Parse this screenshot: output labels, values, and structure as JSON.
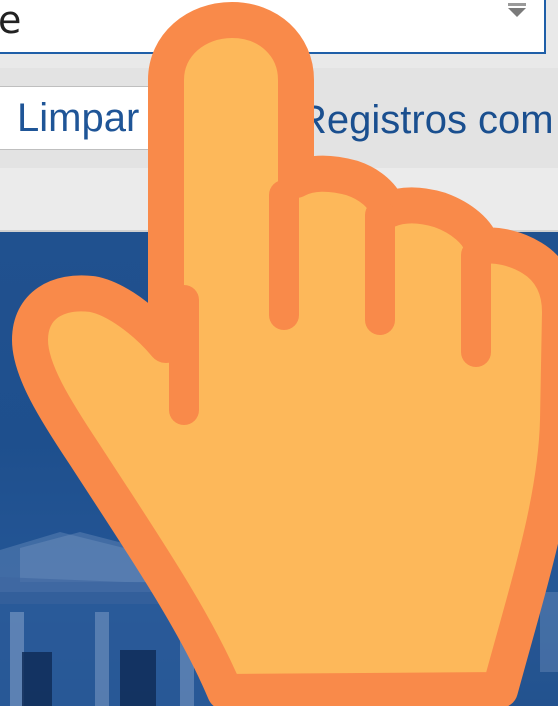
{
  "form": {
    "dropdown_value": "e",
    "clear_button_label": "Limpar",
    "records_label": "Registros com"
  },
  "icons": {
    "dropdown_arrow": "triangle-down-icon",
    "pointer": "hand-pointer-icon"
  },
  "colors": {
    "accent_blue": "#1f5fa8",
    "hero_blue": "#20508f",
    "hand_fill": "#fdb85a",
    "hand_outline": "#f98a4a"
  }
}
